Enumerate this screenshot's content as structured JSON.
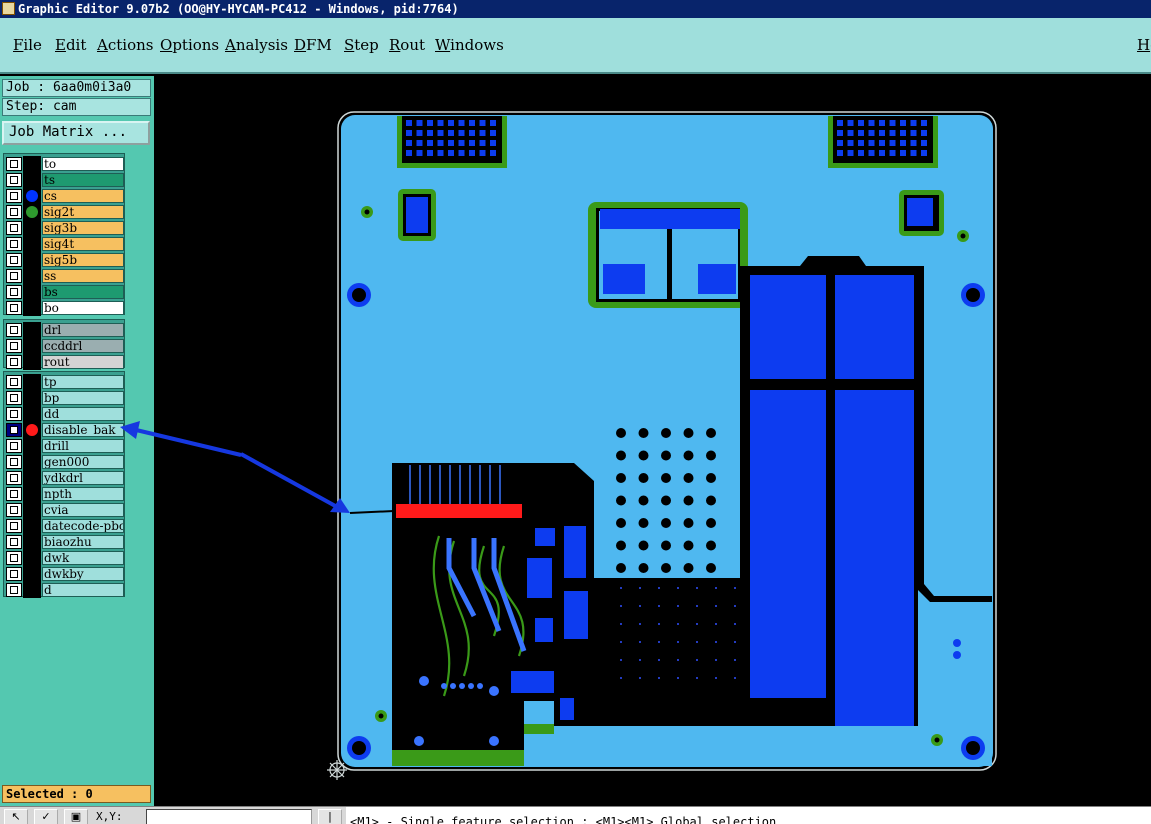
{
  "window": {
    "title": "Graphic Editor 9.07b2 (OO@HY-HYCAM-PC412 - Windows, pid:7764)"
  },
  "menu": {
    "items": [
      "File",
      "Edit",
      "Actions",
      "Options",
      "Analysis",
      "DFM",
      "Step",
      "Rout",
      "Windows"
    ],
    "help": "He"
  },
  "info": {
    "job": "Job : 6aa0m0i3a0",
    "step": "Step: cam",
    "job_matrix": "Job Matrix ..."
  },
  "layers": {
    "group1": [
      {
        "name": "to",
        "color": "#ffffff"
      },
      {
        "name": "ts",
        "color": "#1e9a70"
      },
      {
        "name": "cs",
        "color": "#f6c060",
        "dot": "#0033ff"
      },
      {
        "name": "sig2t",
        "color": "#f6c060",
        "dot": "#2e9a2e"
      },
      {
        "name": "sig3b",
        "color": "#f6c060"
      },
      {
        "name": "sig4t",
        "color": "#f6c060"
      },
      {
        "name": "sig5b",
        "color": "#f6c060"
      },
      {
        "name": "ss",
        "color": "#f6c060"
      },
      {
        "name": "bs",
        "color": "#1e9a70"
      },
      {
        "name": "bo",
        "color": "#ffffff"
      }
    ],
    "group2": [
      {
        "name": "drl",
        "color": "#9aaeb0"
      },
      {
        "name": "ccddrl",
        "color": "#9aaeb0"
      },
      {
        "name": "rout",
        "color": "#d4d4d4"
      }
    ],
    "group3": [
      {
        "name": "tp",
        "color": "#9fdfdc"
      },
      {
        "name": "bp",
        "color": "#9fdfdc"
      },
      {
        "name": "dd",
        "color": "#9fdfdc"
      },
      {
        "name": "disable_bak",
        "color": "#9fdfdc",
        "dot": "#ff1a1a",
        "selected": true
      },
      {
        "name": "drill",
        "color": "#9fdfdc"
      },
      {
        "name": "gen000",
        "color": "#9fdfdc"
      },
      {
        "name": "ydkdrl",
        "color": "#9fdfdc"
      },
      {
        "name": "npth",
        "color": "#9fdfdc"
      },
      {
        "name": "cvia",
        "color": "#9fdfdc"
      },
      {
        "name": "datecode-pbc",
        "color": "#9fdfdc"
      },
      {
        "name": "biaozhu",
        "color": "#9fdfdc"
      },
      {
        "name": "dwk",
        "color": "#9fdfdc"
      },
      {
        "name": "dwkby",
        "color": "#9fdfdc"
      },
      {
        "name": "d",
        "color": "#9fdfdc"
      }
    ]
  },
  "status": {
    "selected": "Selected : 0",
    "xy_label": "X,Y:",
    "xy_value": "",
    "hint": "<M1> - Single feature selection ; <M1><M1> Global selection"
  },
  "colors": {
    "board": "#4fb8f0",
    "copper": "#0d3cf0",
    "mask": "#3a9a18",
    "highlight": "#ff1a1a",
    "arrow": "#1638e0"
  }
}
